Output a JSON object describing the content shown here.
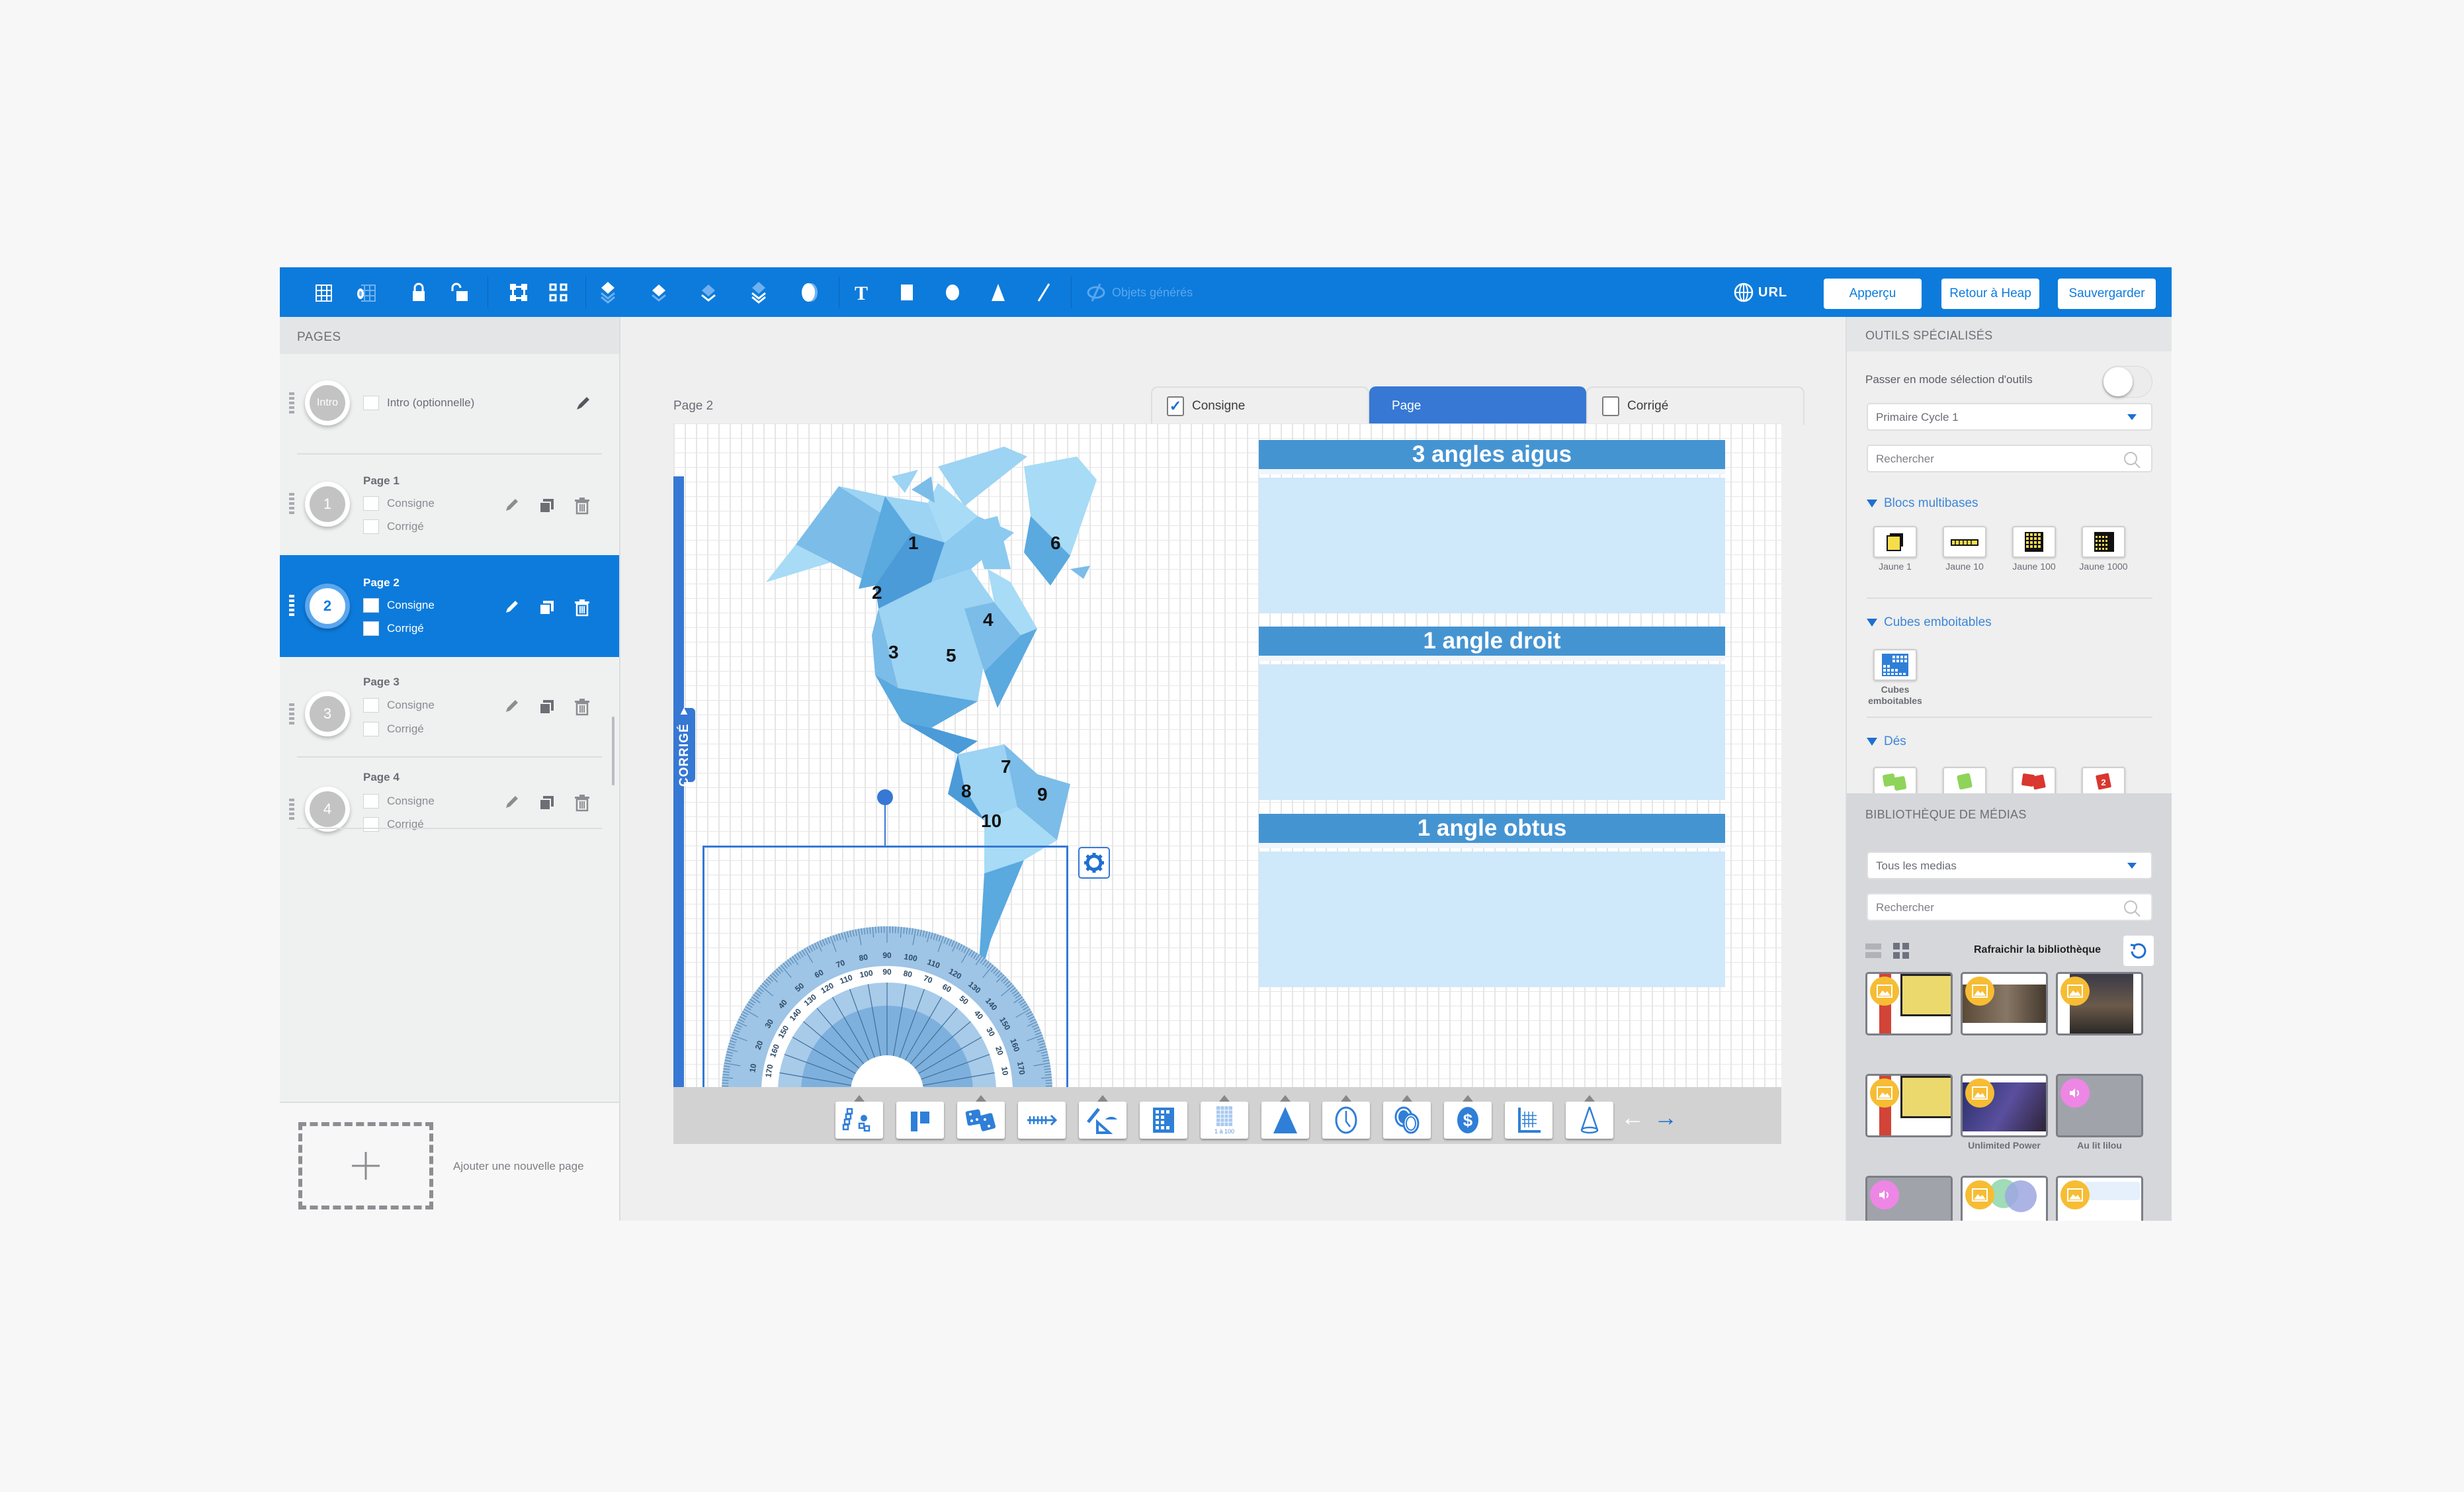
{
  "toolbar": {
    "icons": [
      "grid-snap-icon",
      "grid-hide-icon",
      "lock-icon",
      "unlock-icon",
      "group-icon",
      "ungroup-icon",
      "bring-to-front-icon",
      "bring-forward-icon",
      "send-backward-icon",
      "send-to-back-icon",
      "mask-icon",
      "text-icon",
      "rectangle-icon",
      "circle-icon",
      "triangle-icon",
      "line-icon"
    ],
    "generated_objects_label": "Objets générés",
    "url_label": "URL",
    "preview_label": "Apperçu",
    "back_label": "Retour à Heap",
    "save_label": "Sauvergarder",
    "accent_color": "#0d7bdc"
  },
  "pages_panel": {
    "title": "PAGES",
    "intro": {
      "circle": "Intro",
      "label": "Intro (optionnelle)"
    },
    "pages": [
      {
        "number": "1",
        "title": "Page 1",
        "consigne": "Consigne",
        "corrige": "Corrigé",
        "active": false
      },
      {
        "number": "2",
        "title": "Page 2",
        "consigne": "Consigne",
        "corrige": "Corrigé",
        "active": true
      },
      {
        "number": "3",
        "title": "Page 3",
        "consigne": "Consigne",
        "corrige": "Corrigé",
        "active": false
      },
      {
        "number": "4",
        "title": "Page 4",
        "consigne": "Consigne",
        "corrige": "Corrigé",
        "active": false
      }
    ],
    "add_page_label": "Ajouter une nouvelle page"
  },
  "editor": {
    "page_label": "Page 2",
    "tabs": [
      {
        "label": "Consigne",
        "checked": true,
        "active": false
      },
      {
        "label": "Page",
        "active": true
      },
      {
        "label": "Corrigé",
        "checked": false,
        "active": false
      }
    ],
    "corrige_tab": "CORRIGÉ ▾",
    "map_numbers": [
      "1",
      "2",
      "3",
      "4",
      "5",
      "6",
      "7",
      "8",
      "9",
      "10"
    ],
    "categories": [
      "3 angles aigus",
      "1 angle droit",
      "1 angle obtus"
    ],
    "protractor_outer_labels": [
      "10",
      "20",
      "30",
      "40",
      "50",
      "60",
      "70",
      "80",
      "90",
      "100",
      "110",
      "120",
      "130",
      "140",
      "150",
      "160",
      "170"
    ],
    "bottom_tools": [
      "multibase-blocks-tool",
      "interlocking-cubes-tool",
      "dice-tool",
      "number-line-tool",
      "geometry-tools",
      "hundred-chart-tool",
      "grid-1-to-100-tool",
      "triangle-shape-tool",
      "clock-tool",
      "coins-tool",
      "money-tool",
      "graph-tool",
      "cone-tool"
    ],
    "grid_tool_caption": "1 à 100"
  },
  "tools_panel": {
    "title": "OUTILS SPÉCIALISÉS",
    "toggle_label": "Passer en mode sélection d'outils",
    "toggle_on": false,
    "level_select": "Primaire Cycle 1",
    "search_placeholder": "Rechercher",
    "sections": [
      {
        "title": "Blocs multibases",
        "items": [
          "Jaune 1",
          "Jaune 10",
          "Jaune 100",
          "Jaune 1000"
        ]
      },
      {
        "title": "Cubes emboitables",
        "items": [
          "Cubes emboitables"
        ]
      },
      {
        "title": "Dés",
        "items": [
          "dice-green-pair",
          "dice-green-single",
          "dice-red-pair",
          "dice-red-single"
        ]
      }
    ]
  },
  "media_panel": {
    "title": "BIBLIOTHÈQUE DE MÉDIAS",
    "filter_select": "Tous les medias",
    "search_placeholder": "Rechercher",
    "refresh_label": "Rafraichir la bibliothèque",
    "items": [
      {
        "type": "image",
        "label": ""
      },
      {
        "type": "image",
        "label": ""
      },
      {
        "type": "image",
        "label": ""
      },
      {
        "type": "image",
        "label": ""
      },
      {
        "type": "image",
        "label": "Unlimited Power"
      },
      {
        "type": "audio",
        "label": "Au lit lilou"
      },
      {
        "type": "audio",
        "label": ""
      },
      {
        "type": "image",
        "label": ""
      },
      {
        "type": "image",
        "label": ""
      }
    ]
  }
}
